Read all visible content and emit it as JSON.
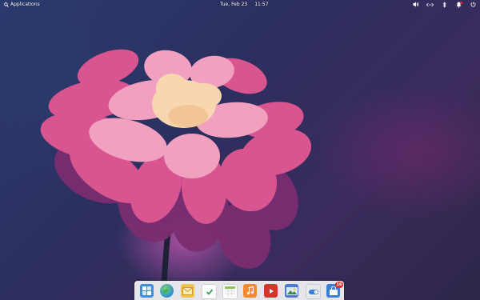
{
  "panel": {
    "applications_label": "Applications",
    "date": "Tue, Feb 23",
    "time": "11:57"
  },
  "indicators": [
    {
      "name": "volume-icon"
    },
    {
      "name": "network-icon"
    },
    {
      "name": "bluetooth-icon"
    },
    {
      "name": "notifications-icon"
    },
    {
      "name": "power-icon"
    }
  ],
  "dock": {
    "items": [
      {
        "name": "multitasking-view",
        "color": "#3f8ee0"
      },
      {
        "name": "web-browser",
        "color": "#2a8fd8"
      },
      {
        "name": "mail",
        "color": "#f2c14e"
      },
      {
        "name": "tasks",
        "color": "#ffffff"
      },
      {
        "name": "calendar",
        "color": "#ffffff"
      },
      {
        "name": "music",
        "color": "#f28b2e"
      },
      {
        "name": "videos",
        "color": "#d9342b"
      },
      {
        "name": "photos",
        "color": "#4a7bd0"
      },
      {
        "name": "system-settings",
        "color": "#5a6a80"
      },
      {
        "name": "appcenter",
        "color": "#3a7fd6"
      }
    ],
    "appcenter_badge": "16"
  },
  "colors": {
    "panel_text": "#ffffff",
    "dock_bg": "#f5f5f5",
    "badge": "#e0302b"
  }
}
